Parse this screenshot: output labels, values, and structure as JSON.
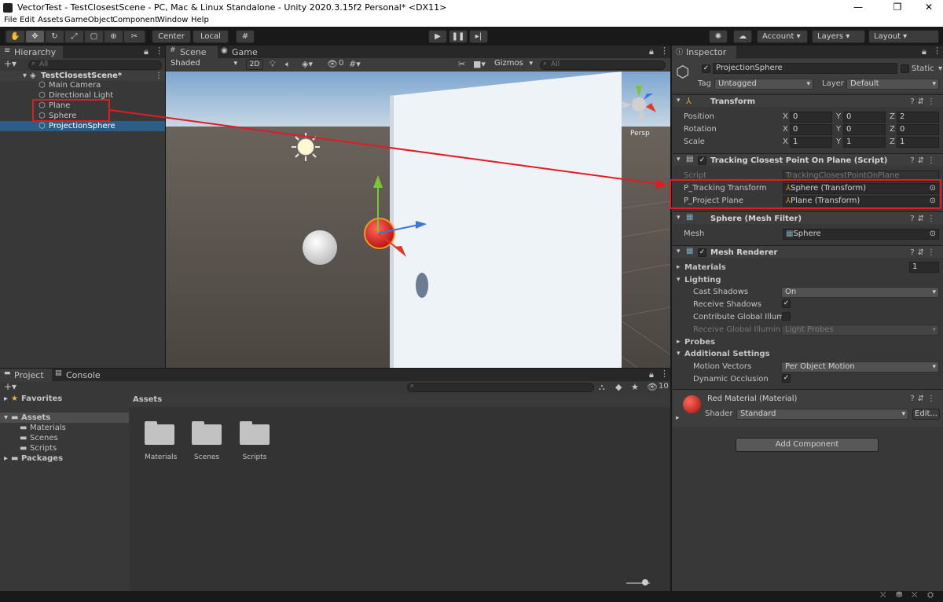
{
  "window": {
    "title": "VectorTest - TestClosestScene - PC, Mac & Linux Standalone - Unity 2020.3.15f2 Personal* <DX11>"
  },
  "menu": [
    "File",
    "Edit",
    "Assets",
    "GameObject",
    "Component",
    "Window",
    "Help"
  ],
  "toolbar": {
    "center": "Center",
    "local": "Local",
    "account": "Account",
    "layers": "Layers",
    "layout": "Layout"
  },
  "hierarchy": {
    "tab": "Hierarchy",
    "search_placeholder": "All",
    "scene": "TestClosestScene*",
    "items": [
      "Main Camera",
      "Directional Light",
      "Plane",
      "Sphere",
      "ProjectionSphere"
    ]
  },
  "scene_view": {
    "tabs": [
      "Scene",
      "Game"
    ],
    "shading": "Shaded",
    "mode_2d": "2D",
    "hidden_count": "0",
    "gizmos": "Gizmos",
    "search_placeholder": "All",
    "persp": "Persp"
  },
  "project": {
    "tabs": [
      "Project",
      "Console"
    ],
    "favorites": "Favorites",
    "assets": "Assets",
    "asset_children": [
      "Materials",
      "Scenes",
      "Scripts"
    ],
    "packages": "Packages",
    "breadcrumb": "Assets",
    "folders": [
      "Materials",
      "Scenes",
      "Scripts"
    ],
    "hidden_count": "10"
  },
  "inspector": {
    "tab": "Inspector",
    "object_name": "ProjectionSphere",
    "static_label": "Static",
    "tag_label": "Tag",
    "tag_value": "Untagged",
    "layer_label": "Layer",
    "layer_value": "Default",
    "transform": {
      "title": "Transform",
      "position_label": "Position",
      "position": [
        "0",
        "0",
        "2"
      ],
      "rotation_label": "Rotation",
      "rotation": [
        "0",
        "0",
        "0"
      ],
      "scale_label": "Scale",
      "scale": [
        "1",
        "1",
        "1"
      ]
    },
    "script": {
      "title": "Tracking Closest Point On Plane (Script)",
      "script_label": "Script",
      "script_value": "TrackingClosestPointOnPlane",
      "p_tracking_label": "P_Tracking Transform",
      "p_tracking_value": "Sphere (Transform)",
      "p_plane_label": "P_Project Plane",
      "p_plane_value": "Plane (Transform)"
    },
    "mesh_filter": {
      "title": "Sphere (Mesh Filter)",
      "mesh_label": "Mesh",
      "mesh_value": "Sphere"
    },
    "mesh_renderer": {
      "title": "Mesh Renderer",
      "materials_label": "Materials",
      "materials_count": "1",
      "lighting_label": "Lighting",
      "cast_shadows_label": "Cast Shadows",
      "cast_shadows_value": "On",
      "receive_shadows_label": "Receive Shadows",
      "contribute_gi_label": "Contribute Global Illumi",
      "receive_gi_label": "Receive Global Illumina",
      "receive_gi_value": "Light Probes",
      "probes_label": "Probes",
      "additional_label": "Additional Settings",
      "motion_vectors_label": "Motion Vectors",
      "motion_vectors_value": "Per Object Motion",
      "dynamic_occlusion_label": "Dynamic Occlusion"
    },
    "material": {
      "title": "Red Material (Material)",
      "shader_label": "Shader",
      "shader_value": "Standard",
      "edit": "Edit..."
    },
    "add_component": "Add Component"
  },
  "colors": {
    "accent_red": "#e11b22",
    "selection": "#2c5d87"
  }
}
